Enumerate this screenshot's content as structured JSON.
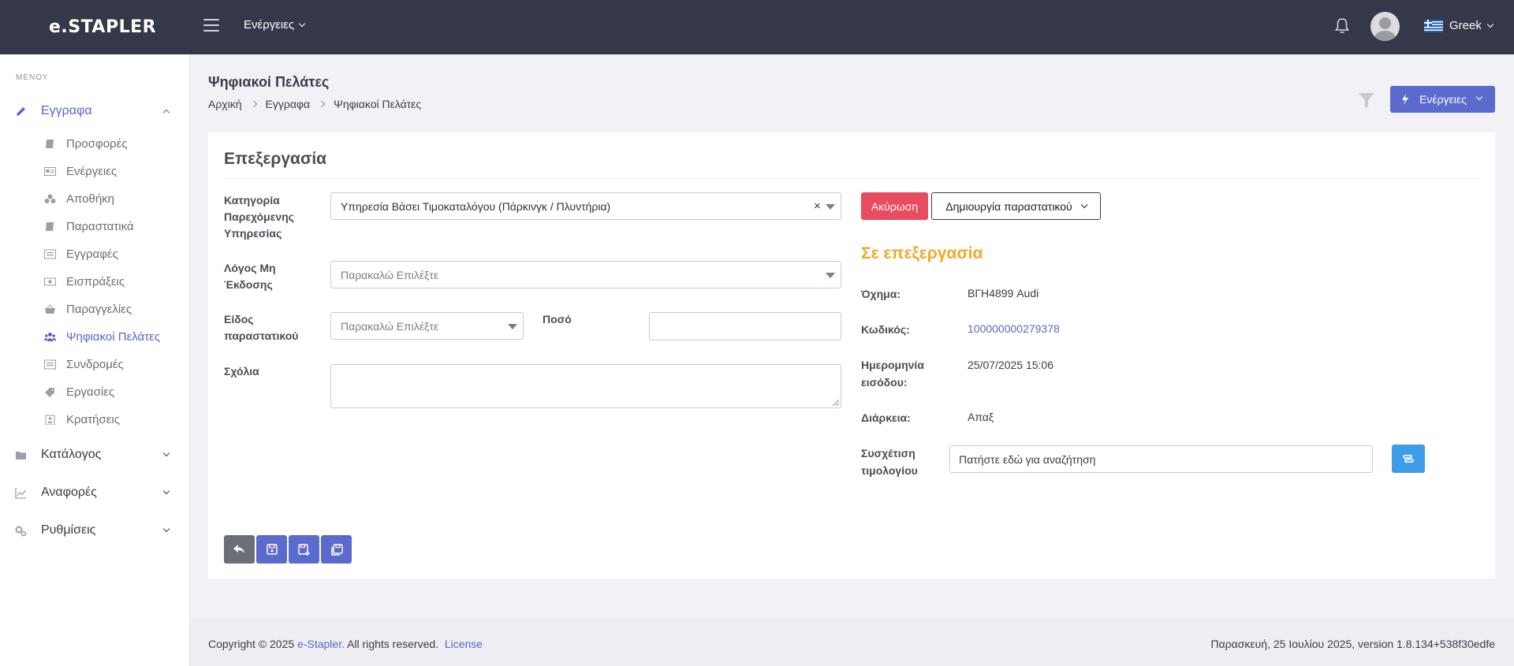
{
  "topbar": {
    "logo": "e.STAPLER",
    "actions_label": "Ενέργειες",
    "language": "Greek"
  },
  "sidebar": {
    "menu_title": "ΜΕΝΟΥ",
    "documents": {
      "label": "Εγγραφα",
      "items": [
        {
          "label": "Προσφορές",
          "icon": "book-icon"
        },
        {
          "label": "Ενέργειες",
          "icon": "id-card-icon"
        },
        {
          "label": "Αποθήκη",
          "icon": "boxes-icon"
        },
        {
          "label": "Παραστατικά",
          "icon": "book-icon"
        },
        {
          "label": "Εγγραφές",
          "icon": "list-icon"
        },
        {
          "label": "Εισπράξεις",
          "icon": "money-icon"
        },
        {
          "label": "Παραγγελίες",
          "icon": "basket-icon"
        },
        {
          "label": "Ψηφιακοί Πελάτες",
          "icon": "users-icon",
          "active": true
        },
        {
          "label": "Συνδρομές",
          "icon": "list-icon"
        },
        {
          "label": "Εργασίες",
          "icon": "tag-icon"
        },
        {
          "label": "Κρατήσεις",
          "icon": "clipboard-icon"
        }
      ]
    },
    "catalog_label": "Κατάλογος",
    "reports_label": "Αναφορές",
    "settings_label": "Ρυθμίσεις"
  },
  "page": {
    "title": "Ψηφιακοί Πελάτες",
    "breadcrumb": [
      "Αρχική",
      "Εγγραφα",
      "Ψηφιακοί Πελάτες"
    ],
    "actions_button": "Ενέργειες"
  },
  "form": {
    "title": "Επεξεργασία",
    "category_label_1": "Κατηγορία",
    "category_label_2": "Παρεχόμενης",
    "category_label_3": "Υπηρεσίας",
    "category_value": "Υπηρεσία Βάσει Τιμοκαταλόγου (Πάρκινγκ / Πλυντήρια)",
    "reason_label_1": "Λόγος Μη",
    "reason_label_2": "Έκδοσης",
    "reason_placeholder": "Παρακαλώ Επιλέξτε",
    "doc_type_label_1": "Είδος",
    "doc_type_label_2": "παραστατικού",
    "doc_type_placeholder": "Παρακαλώ Επιλέξτε",
    "amount_label": "Ποσό",
    "amount_value": "",
    "comments_label": "Σχόλια",
    "comments_value": ""
  },
  "details": {
    "cancel_button": "Ακύρωση",
    "create_button": "Δημιουργία παραστατικού",
    "status": "Σε επεξεργασία",
    "vehicle_label": "Όχημα:",
    "vehicle_value": "ΒΓΗ4899 Audi",
    "code_label": "Κωδικός:",
    "code_value": "100000000279378",
    "entry_label_1": "Ημερομηνία",
    "entry_label_2": "εισόδου:",
    "entry_value": "25/07/2025 15:06",
    "duration_label": "Διάρκεια:",
    "duration_value": "Απαξ",
    "invoice_label_1": "Συσχέτιση",
    "invoice_label_2": "τιμολογίου",
    "invoice_placeholder": "Πατήστε εδώ για αναζήτηση"
  },
  "footer": {
    "copyright_prefix": "Copyright © 2025",
    "brand": "e-Stapler.",
    "rights": "All rights reserved.",
    "license": "License",
    "right_text": "Παρασκευή, 25 Ιουλίου 2025, version 1.8.134+538f30edfe"
  },
  "colors": {
    "topbar": "#343848",
    "accent": "#5b6acd",
    "danger": "#e94b5f",
    "warning": "#f0a92a",
    "info": "#3f9de8"
  }
}
